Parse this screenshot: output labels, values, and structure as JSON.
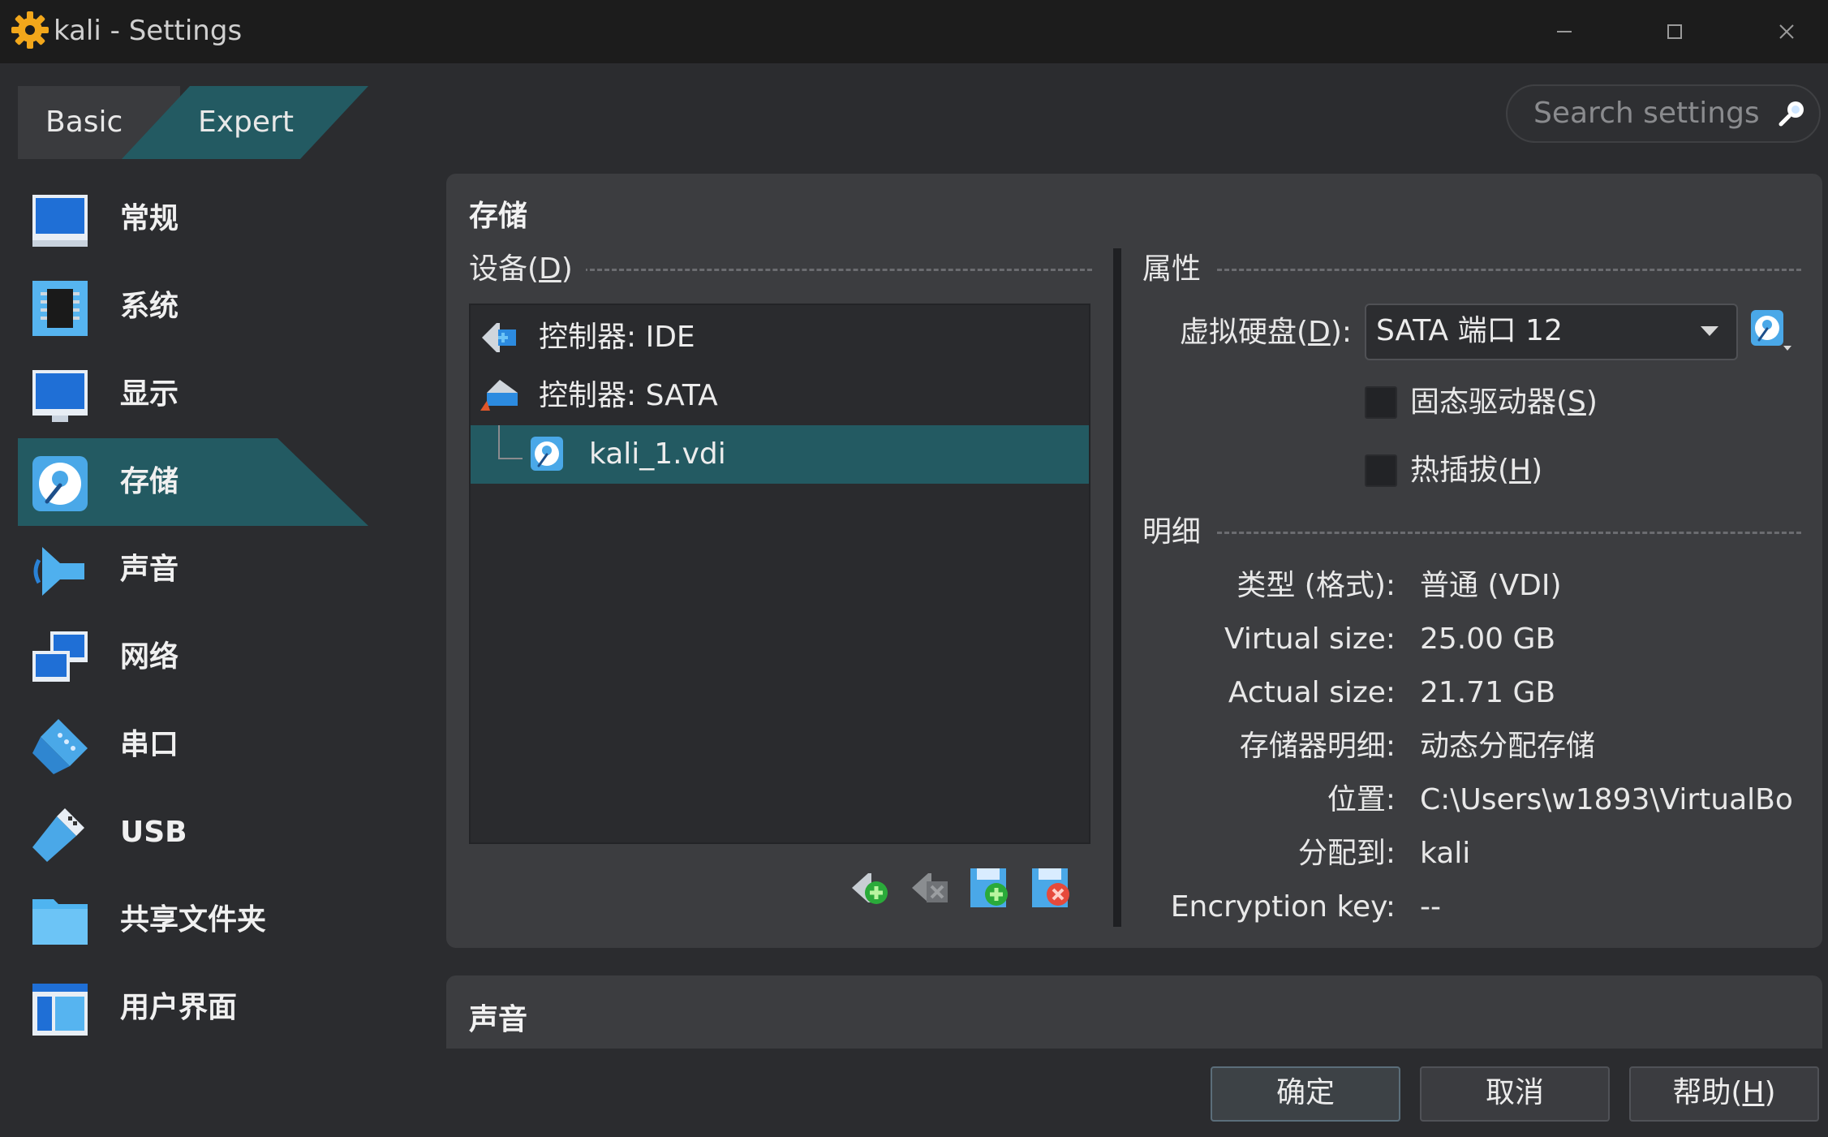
{
  "window": {
    "title": "kali - Settings",
    "icon": "gear-icon",
    "controls": [
      "minimize-icon",
      "maximize-icon",
      "close-icon"
    ]
  },
  "mode_tabs": {
    "basic": "Basic",
    "expert": "Expert",
    "selected": "Expert"
  },
  "search": {
    "placeholder": "Search settings",
    "icon": "search-icon"
  },
  "sidebar": {
    "items": [
      {
        "label": "常规",
        "icon": "general-monitor-icon"
      },
      {
        "label": "系统",
        "icon": "system-chip-icon"
      },
      {
        "label": "显示",
        "icon": "display-monitor-icon"
      },
      {
        "label": "存储",
        "icon": "storage-disk-icon",
        "selected": true
      },
      {
        "label": "声音",
        "icon": "audio-speaker-icon"
      },
      {
        "label": "网络",
        "icon": "network-icon"
      },
      {
        "label": "串口",
        "icon": "serial-port-icon"
      },
      {
        "label": "USB",
        "icon": "usb-icon"
      },
      {
        "label": "共享文件夹",
        "icon": "shared-folder-icon"
      },
      {
        "label": "用户界面",
        "icon": "user-interface-icon"
      }
    ]
  },
  "storage": {
    "section_title": "存储",
    "devices_label": "设备(",
    "devices_mnemonic": "D",
    "devices_close": ")",
    "tree": [
      {
        "label": "控制器: IDE",
        "icon": "ide-controller-icon",
        "level": 0
      },
      {
        "label": "控制器: SATA",
        "icon": "sata-controller-icon",
        "level": 0
      },
      {
        "label": "kali_1.vdi",
        "icon": "hard-disk-icon",
        "level": 1,
        "selected": true
      }
    ],
    "toolbar": [
      "add-controller-icon",
      "remove-controller-icon",
      "add-attachment-icon",
      "remove-attachment-icon"
    ],
    "attributes": {
      "title": "属性",
      "hard_disk_label": "虚拟硬盘(",
      "hard_disk_mnemonic": "D",
      "hard_disk_close": "):",
      "hard_disk_value": "SATA 端口 12",
      "ssd_label": "固态驱动器(",
      "ssd_mnemonic": "S",
      "ssd_close": ")",
      "ssd_checked": false,
      "hotplug_label": "热插拔(",
      "hotplug_mnemonic": "H",
      "hotplug_close": ")",
      "hotplug_checked": false
    },
    "details": {
      "title": "明细",
      "rows": [
        {
          "label": "类型 (格式):",
          "value": "普通 (VDI)"
        },
        {
          "label": "Virtual size:",
          "value": "25.00 GB"
        },
        {
          "label": "Actual size:",
          "value": "21.71 GB"
        },
        {
          "label": "存储器明细:",
          "value": "动态分配存储"
        },
        {
          "label": "位置:",
          "value": "C:\\Users\\w1893\\VirtualBo.."
        },
        {
          "label": "分配到:",
          "value": "kali"
        },
        {
          "label": "Encryption key:",
          "value": "--"
        }
      ]
    }
  },
  "audio_section": {
    "title": "声音"
  },
  "buttons": {
    "ok": "确定",
    "cancel": "取消",
    "help_label": "帮助(",
    "help_mnemonic": "H",
    "help_close": ")"
  },
  "colors": {
    "accent": "#235a62",
    "background": "#2b2c2f",
    "panel": "#3c3d40",
    "titlebar": "#1c1c1c"
  }
}
